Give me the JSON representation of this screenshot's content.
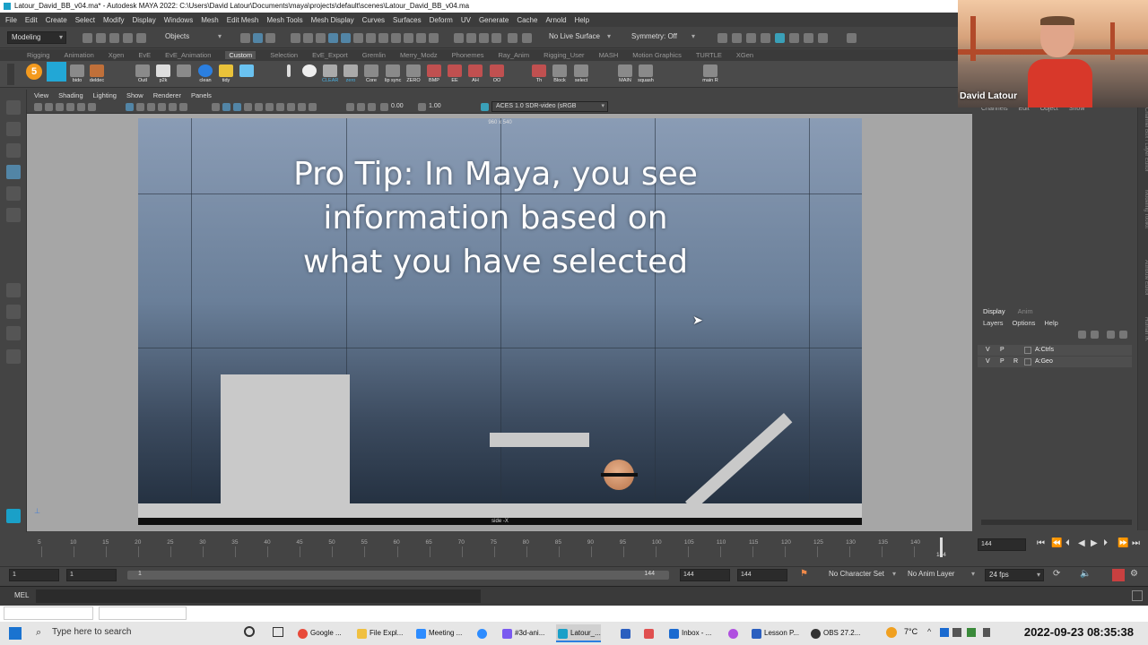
{
  "window": {
    "title": "Latour_David_BB_v04.ma* - Autodesk MAYA 2022: C:\\Users\\David Latour\\Documents\\maya\\projects\\default\\scenes\\Latour_David_BB_v04.ma"
  },
  "menubar": [
    "File",
    "Edit",
    "Create",
    "Select",
    "Modify",
    "Display",
    "Windows",
    "Mesh",
    "Edit Mesh",
    "Mesh Tools",
    "Mesh Display",
    "Curves",
    "Surfaces",
    "Deform",
    "UV",
    "Generate",
    "Cache",
    "Arnold",
    "Help"
  ],
  "statusline": {
    "mode": "Modeling",
    "selection_mode": "Objects",
    "live_surface": "No Live Surface",
    "symmetry": "Symmetry: Off"
  },
  "shelf_tabs": [
    "Rigging",
    "Animation",
    "Xgen",
    "EvE",
    "EvE_Animation",
    "Custom",
    "Selection",
    "EvE_Export",
    "Gremlin",
    "Merry_Modz",
    "Phonemes",
    "Ray_Anim",
    "Rigging_User",
    "MASH",
    "Motion Graphics",
    "TURTLE",
    "XGen"
  ],
  "shelf_active": "Custom",
  "shelf_buttons": [
    "bido",
    "deldec",
    "Outl",
    "p2k",
    "",
    "clean",
    "tidy",
    "",
    "",
    "CLEAR",
    "zero",
    "Core",
    "lip sync",
    "ZERO",
    "BMP",
    "EE",
    "AH",
    "OO",
    "Th",
    "Block",
    "select",
    "MAIN",
    "squash",
    "main R"
  ],
  "panel_menu": [
    "View",
    "Shading",
    "Lighting",
    "Show",
    "Renderer",
    "Panels"
  ],
  "panel_toolbar": {
    "exposure": "0.00",
    "gamma": "1.00",
    "color_space": "ACES 1.0 SDR-video (sRGB"
  },
  "viewport": {
    "resolution_label": "960 x 540",
    "camera_label": "side -X",
    "overlay_text": [
      "Pro Tip: In Maya, you see",
      "information based on",
      "what you have selected"
    ]
  },
  "channel_box": {
    "menu": [
      "Channels",
      "Edit",
      "Object",
      "Show"
    ]
  },
  "layer_editor": {
    "tabs": [
      "Display",
      "Anim"
    ],
    "active_tab": "Display",
    "menu": [
      "Layers",
      "Options",
      "Help"
    ],
    "layers": [
      {
        "v": "V",
        "p": "P",
        "r": "",
        "name": "A:Ctrls"
      },
      {
        "v": "V",
        "p": "P",
        "r": "R",
        "name": "A:Geo"
      }
    ]
  },
  "side_tabs": [
    "Channel Box / Layer Editor",
    "Modeling Toolkit",
    "Attribute Editor",
    "Human IK"
  ],
  "webcam": {
    "name": "David Latour"
  },
  "timeline": {
    "ticks": [
      "5",
      "10",
      "15",
      "20",
      "25",
      "30",
      "35",
      "40",
      "45",
      "50",
      "55",
      "60",
      "65",
      "70",
      "75",
      "80",
      "85",
      "90",
      "95",
      "100",
      "105",
      "110",
      "115",
      "120",
      "125",
      "130",
      "135",
      "140"
    ],
    "current_frame": "144",
    "end_marker": "144"
  },
  "range": {
    "start": "1",
    "playback_start": "1",
    "slider_start": "1",
    "slider_end": "144",
    "playback_end": "144",
    "end": "144",
    "character_set": "No Character Set",
    "anim_layer": "No Anim Layer",
    "fps": "24 fps"
  },
  "cmdline": {
    "label": "MEL"
  },
  "taskbar": {
    "search_placeholder": "Type here to search",
    "apps": [
      "Google ...",
      "File Expl...",
      "Meeting ...",
      "",
      "#3d-ani...",
      "Latour_...",
      "",
      "Inbox - ...",
      "",
      "Lesson P...",
      "OBS 27.2..."
    ],
    "weather": "7°C",
    "datetime": "2022-09-23  08:35:38"
  },
  "colors": {
    "maya_bg": "#444444",
    "accent": "#5285a6",
    "webcam_shirt": "#d8382a"
  }
}
